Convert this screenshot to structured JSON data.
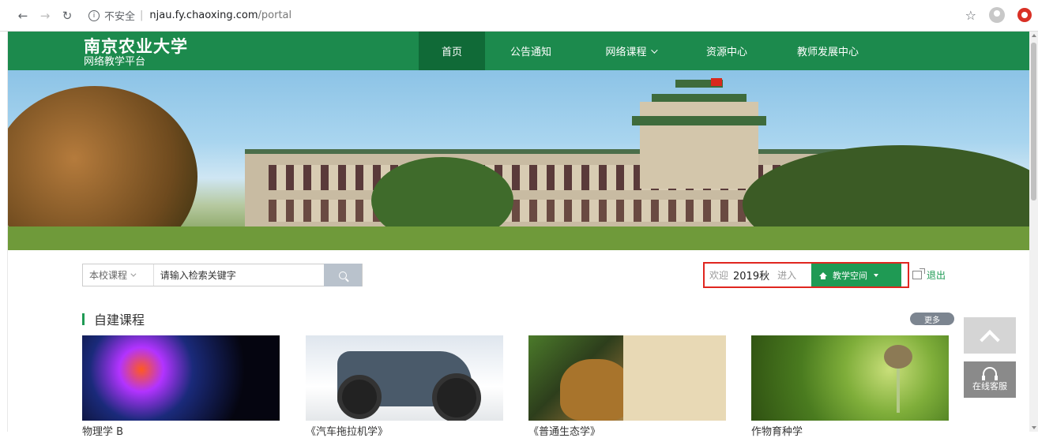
{
  "browser": {
    "insecure_label": "不安全",
    "url_host": "njau.fy.chaoxing.com",
    "url_path": "/portal"
  },
  "site": {
    "title": "南京农业大学",
    "subtitle": "网络教学平台",
    "brand_color": "#1c8a4d"
  },
  "nav": {
    "items": [
      "首页",
      "公告通知",
      "网络课程",
      "资源中心",
      "教师发展中心"
    ],
    "active_index": 0
  },
  "search": {
    "scope": "本校课程",
    "placeholder": "请输入检索关键字"
  },
  "user": {
    "welcome": "欢迎",
    "term": "2019秋",
    "enter": "进入",
    "space_button": "教学空间",
    "logout": "退出"
  },
  "section": {
    "title": "自建课程",
    "more": "更多"
  },
  "courses": [
    {
      "name": "物理学 B"
    },
    {
      "name": "《汽车拖拉机学》"
    },
    {
      "name": "《普通生态学》"
    },
    {
      "name": "作物育种学"
    }
  ],
  "float_tools": {
    "service_label": "在线客服"
  },
  "icons": [
    "back-arrow-icon",
    "forward-arrow-icon",
    "reload-icon",
    "info-icon",
    "star-icon",
    "profile-icon",
    "extension-icon",
    "search-icon",
    "home-icon",
    "logout-icon",
    "chevron-up-icon",
    "headset-icon"
  ]
}
